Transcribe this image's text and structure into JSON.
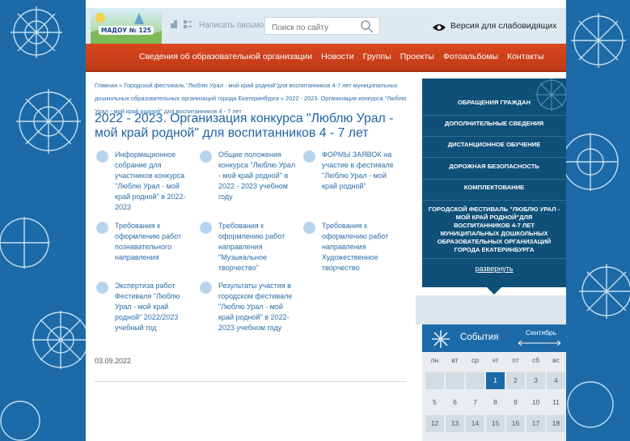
{
  "header": {
    "logo_text": "МАДОУ № 125",
    "write_letter": "Написать письмо",
    "search_placeholder": "Поиск по сайту",
    "accessibility": "Версия для слабовидящих"
  },
  "nav": {
    "items": [
      "Сведения об образовательной организации",
      "Новости",
      "Группы",
      "Проекты",
      "Фотоальбомы",
      "Контакты"
    ]
  },
  "breadcrumbs": "Главная » Городской фестиваль \"Люблю Урал - мой край родной\"для воспитанников 4-7 лет муниципальных дошкольных образовательных организаций города Екатеринбурга » 2022 - 2023. Организация конкурса \"Люблю Урал - мой край родной\" для воспитанников 4 - 7 лет",
  "page_title": "2022 - 2023. Организация конкурса \"Люблю Урал - мой край родной\" для воспитанников 4 - 7 лет",
  "items": [
    "Информационное собрание для участников конкурса \"Люблю Урал - мой край родной\" в 2022-2023",
    "Общие положения конкурса \"Люблю Урал - мой край родной\" в 2022 - 2023 учебном году",
    "ФОРМЫ ЗАЯВОК на участие в фестивале \"Люблю Урал - мой край родной\"",
    "Требования к оформлению работ познавательного направления",
    "Требования к оформлению работ направления \"Музыкальное творчество\"",
    "Требования к оформлению работ направления Художественное творчество",
    "Экспертиза работ Фестиваля \"Люблю Урал - мой край родной\" 2022/2023 учебный год",
    "Результаты участия в городском фестивале \"Люблю Урал - мой край родной\" в 2022-2023 учебном году"
  ],
  "date": "03.09.2022",
  "sidebar": {
    "items": [
      "ОБРАЩЕНИЯ ГРАЖДАН",
      "ДОПОЛНИТЕЛЬНЫЕ СВЕДЕНИЯ",
      "ДИСТАНЦИОННОЕ ОБУЧЕНИЕ",
      "ДОРОЖНАЯ БЕЗОПАСНОСТЬ",
      "КОМПЛЕКТОВАНИЕ",
      "ГОРОДСКОЙ ФЕСТИВАЛЬ \"ЛЮБЛЮ УРАЛ - МОЙ КРАЙ РОДНОЙ\"ДЛЯ ВОСПИТАННИКОВ 4-7 ЛЕТ МУНИЦИПАЛЬНЫХ ДОШКОЛЬНЫХ ОБРАЗОВАТЕЛЬНЫХ ОРГАНИЗАЦИЙ ГОРОДА ЕКАТЕРИНБУРГА"
    ],
    "expand": "развернуть"
  },
  "calendar": {
    "title": "События",
    "month": "Сентябрь",
    "weekdays": [
      "пн",
      "вт",
      "ср",
      "чт",
      "пт",
      "сб",
      "вс"
    ],
    "row1": [
      "",
      "",
      "",
      "1",
      "2",
      "3",
      "4"
    ],
    "row2": [
      "5",
      "6",
      "7",
      "8",
      "9",
      "10",
      "11"
    ],
    "row3": [
      "12",
      "13",
      "14",
      "15",
      "16",
      "17",
      "18"
    ],
    "today": "1"
  },
  "colors": {
    "accent_red": "#c13a17",
    "link_blue": "#2d6da8",
    "sidebar_navy": "#0f5078"
  }
}
